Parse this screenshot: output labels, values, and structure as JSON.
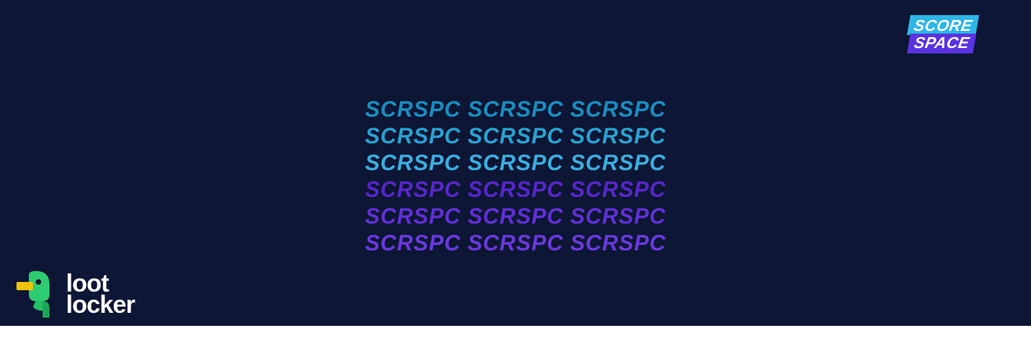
{
  "colors": {
    "bg": "#0d1634",
    "cyan1": "#1a8dbf",
    "cyan2": "#2aa1d1",
    "cyan3": "#3baee0",
    "purple1": "#5826cc",
    "purple2": "#612fd6",
    "purple3": "#6a39e0",
    "scorespace_cyan": "#2db6e6",
    "scorespace_purple": "#5a33e0"
  },
  "scorespace": {
    "top": "SCORE",
    "bot": "SPACE"
  },
  "center": {
    "line1": "SCRSPC SCRSPC SCRSPC",
    "line2": "SCRSPC SCRSPC SCRSPC",
    "line3": "SCRSPC SCRSPC SCRSPC",
    "line4": "SCRSPC SCRSPC SCRSPC",
    "line5": "SCRSPC SCRSPC SCRSPC",
    "line6": "SCRSPC SCRSPC SCRSPC"
  },
  "lootlocker": {
    "line1": "loot",
    "line2": "locker"
  }
}
